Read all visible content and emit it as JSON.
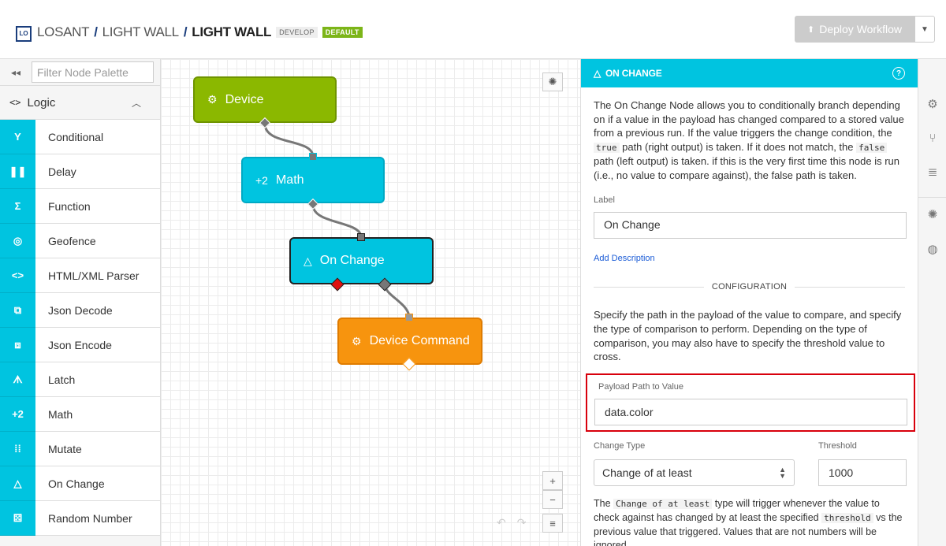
{
  "header": {
    "logo_text": "LO",
    "breadcrumbs": [
      "LOSANT",
      "LIGHT WALL",
      "LIGHT WALL"
    ],
    "badge_develop": "DEVELOP",
    "badge_default": "DEFAULT",
    "deploy_label": "Deploy Workflow"
  },
  "palette": {
    "filter_placeholder": "Filter Node Palette",
    "category": "Logic",
    "items": [
      {
        "label": "Conditional",
        "icon": "conditional-icon",
        "glyph": "Y"
      },
      {
        "label": "Delay",
        "icon": "pause-icon",
        "glyph": "❚❚"
      },
      {
        "label": "Function",
        "icon": "sigma-icon",
        "glyph": "Σ"
      },
      {
        "label": "Geofence",
        "icon": "target-icon",
        "glyph": "◎"
      },
      {
        "label": "HTML/XML Parser",
        "icon": "code-icon",
        "glyph": "<>"
      },
      {
        "label": "Json Decode",
        "icon": "json-decode-icon",
        "glyph": "⧉"
      },
      {
        "label": "Json Encode",
        "icon": "json-encode-icon",
        "glyph": "⧈"
      },
      {
        "label": "Latch",
        "icon": "latch-icon",
        "glyph": "ᗑ"
      },
      {
        "label": "Math",
        "icon": "math-icon",
        "glyph": "+2"
      },
      {
        "label": "Mutate",
        "icon": "mutate-icon",
        "glyph": "⁞⁞"
      },
      {
        "label": "On Change",
        "icon": "triangle-icon",
        "glyph": "△"
      },
      {
        "label": "Random Number",
        "icon": "dice-icon",
        "glyph": "⚄"
      }
    ]
  },
  "workflow": {
    "nodes": [
      {
        "label": "Device",
        "color": "#8bb800"
      },
      {
        "label": "Math",
        "prefix": "+2",
        "color": "#00c4e0"
      },
      {
        "label": "On Change",
        "color": "#00c4e0"
      },
      {
        "label": "Device Command",
        "color": "#f7940e"
      }
    ]
  },
  "panel": {
    "title": "ON CHANGE",
    "description_html": "The On Change Node allows you to conditionally branch depending on if a value in the payload has changed compared to a stored value from a previous run. If the value triggers the change condition, the <code>true</code> path (right output) is taken. If it does not match, the <code>false</code> path (left output) is taken. if this is the very first time this node is run (i.e., no value to compare against), the false path is taken.",
    "label_field_label": "Label",
    "label_field_value": "On Change",
    "add_description": "Add Description",
    "section_title": "CONFIGURATION",
    "config_description": "Specify the path in the payload of the value to compare, and specify the type of comparison to perform. Depending on the type of comparison, you may also have to specify the threshold value to cross.",
    "payload_path_label": "Payload Path to Value",
    "payload_path_value": "data.color",
    "change_type_label": "Change Type",
    "change_type_value": "Change of at least",
    "threshold_label": "Threshold",
    "threshold_value": "1000",
    "help_html": "The <code>Change of at least</code> type will trigger whenever the value to check against has changed by at least the specified <code>threshold</code> vs the previous value that triggered. Values that are not numbers will be ignored."
  }
}
